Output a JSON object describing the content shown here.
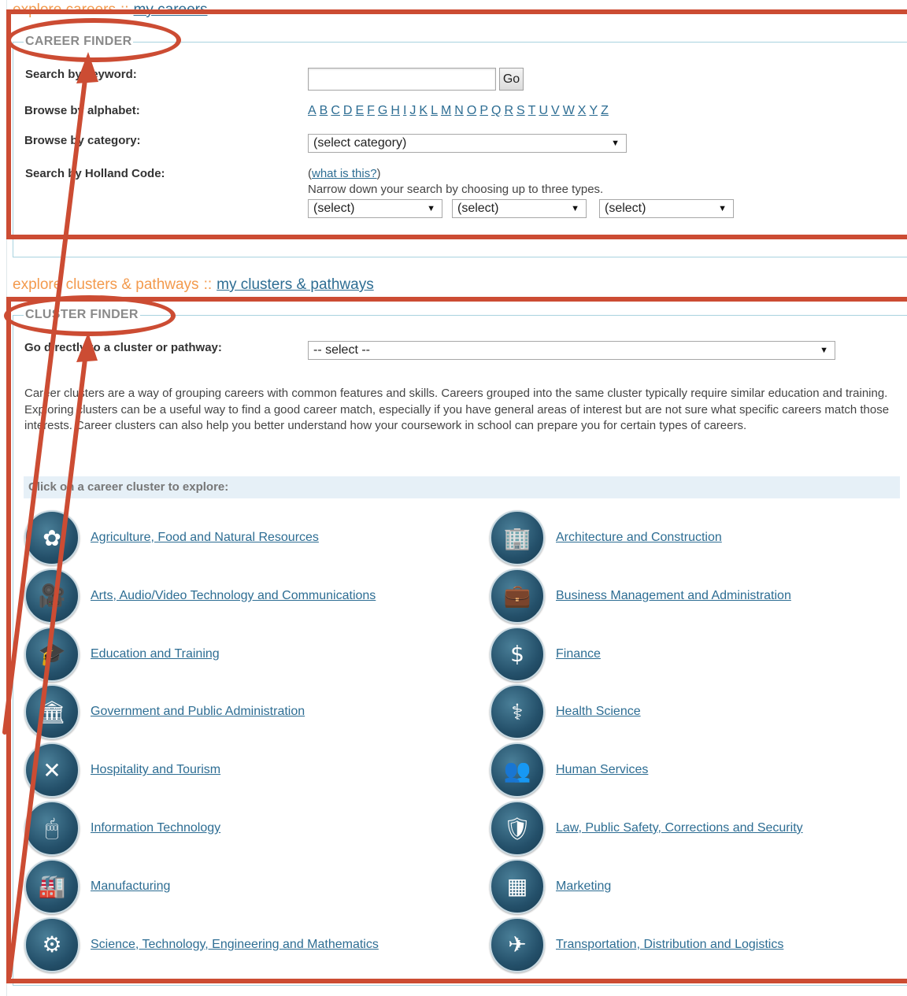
{
  "careers_nav": {
    "explore": "explore careers",
    "separator": "::",
    "mine": "my careers"
  },
  "career_finder": {
    "legend": "CAREER FINDER",
    "keyword_label": "Search by keyword:",
    "keyword_value": "",
    "go_label": "Go",
    "alphabet_label": "Browse by alphabet:",
    "letters": [
      "A",
      "B",
      "C",
      "D",
      "E",
      "F",
      "G",
      "H",
      "I",
      "J",
      "K",
      "L",
      "M",
      "N",
      "O",
      "P",
      "Q",
      "R",
      "S",
      "T",
      "U",
      "V",
      "W",
      "X",
      "Y",
      "Z"
    ],
    "category_label": "Browse by category:",
    "category_selected": "(select category)",
    "holland_label": "Search by Holland Code:",
    "what_is_this": "what is this?",
    "holland_hint": "Narrow down your search by choosing up to three types.",
    "holland_selects": [
      "(select)",
      "(select)",
      "(select)"
    ]
  },
  "clusters_nav": {
    "explore": "explore clusters & pathways",
    "separator": "::",
    "mine": "my clusters & pathways"
  },
  "cluster_finder": {
    "legend": "CLUSTER FINDER",
    "go_directly_label": "Go directly to a cluster or pathway:",
    "select_value": "-- select --",
    "description": "Career clusters are a way of grouping careers with common features and skills. Careers grouped into the same cluster typically require similar education and training. Exploring clusters can be a useful way to find a good career match, especially if you have general areas of interest but are not sure what specific careers match those interests. Career clusters can also help you better understand how your coursework in school can prepare you for certain types of careers.",
    "click_prompt": "Click on a career cluster to explore:",
    "clusters_left": [
      {
        "name": "Agriculture, Food and Natural Resources",
        "icon": "plant-icon"
      },
      {
        "name": "Arts, Audio/Video Technology and Communications",
        "icon": "film-camera-icon"
      },
      {
        "name": "Education and Training",
        "icon": "graduation-cap-icon"
      },
      {
        "name": "Government and Public Administration",
        "icon": "government-building-icon"
      },
      {
        "name": "Hospitality and Tourism",
        "icon": "fork-knife-icon"
      },
      {
        "name": "Information Technology",
        "icon": "computer-mouse-icon"
      },
      {
        "name": "Manufacturing",
        "icon": "factory-icon"
      },
      {
        "name": "Science, Technology, Engineering and Mathematics",
        "icon": "gears-icon"
      }
    ],
    "clusters_right": [
      {
        "name": "Architecture and Construction",
        "icon": "buildings-icon"
      },
      {
        "name": "Business Management and Administration",
        "icon": "briefcase-icon"
      },
      {
        "name": "Finance",
        "icon": "money-icon"
      },
      {
        "name": "Health Science",
        "icon": "caduceus-icon"
      },
      {
        "name": "Human Services",
        "icon": "people-icon"
      },
      {
        "name": "Law, Public Safety, Corrections and Security",
        "icon": "shield-globe-icon"
      },
      {
        "name": "Marketing",
        "icon": "chart-grid-icon"
      },
      {
        "name": "Transportation, Distribution and Logistics",
        "icon": "airplane-icon"
      }
    ]
  },
  "annotation_color": "#cc4c33"
}
